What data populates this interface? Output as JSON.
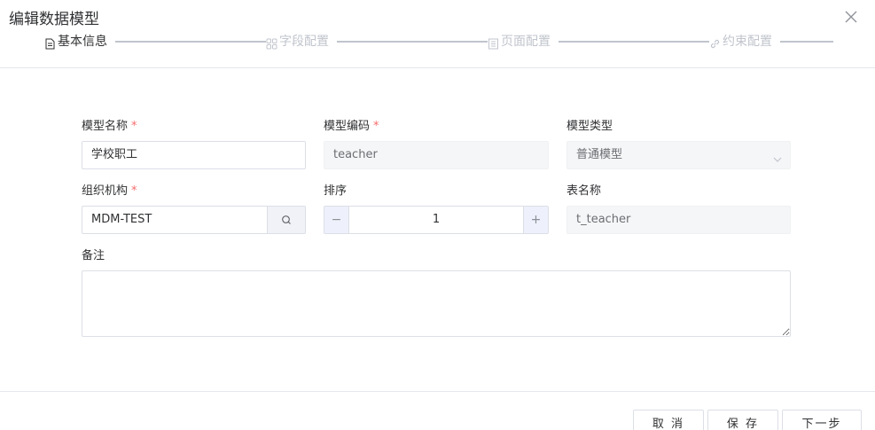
{
  "dialog": {
    "title": "编辑数据模型"
  },
  "steps": [
    {
      "label": "基本信息",
      "icon": "document-icon",
      "active": true
    },
    {
      "label": "字段配置",
      "icon": "grid-icon",
      "active": false
    },
    {
      "label": "页面配置",
      "icon": "page-icon",
      "active": false
    },
    {
      "label": "约束配置",
      "icon": "link-icon",
      "active": false
    }
  ],
  "form": {
    "model_name": {
      "label": "模型名称",
      "required_mark": "*",
      "value": "学校职工"
    },
    "model_code": {
      "label": "模型编码",
      "required_mark": "*",
      "value": "teacher"
    },
    "model_type": {
      "label": "模型类型",
      "value": "普通模型"
    },
    "organization": {
      "label": "组织机构",
      "required_mark": "*",
      "value": "MDM-TEST"
    },
    "sort": {
      "label": "排序",
      "value": "1",
      "minus": "−",
      "plus": "+"
    },
    "table_name": {
      "label": "表名称",
      "value": "t_teacher"
    },
    "remark": {
      "label": "备注",
      "value": ""
    }
  },
  "footer": {
    "cancel_label": "取 消",
    "save_label": "保 存",
    "next_label": "下一步"
  },
  "colors": {
    "required": "#f56c6c",
    "step_inactive": "#c0c4cc",
    "disabled_bg": "#f5f6f7"
  }
}
